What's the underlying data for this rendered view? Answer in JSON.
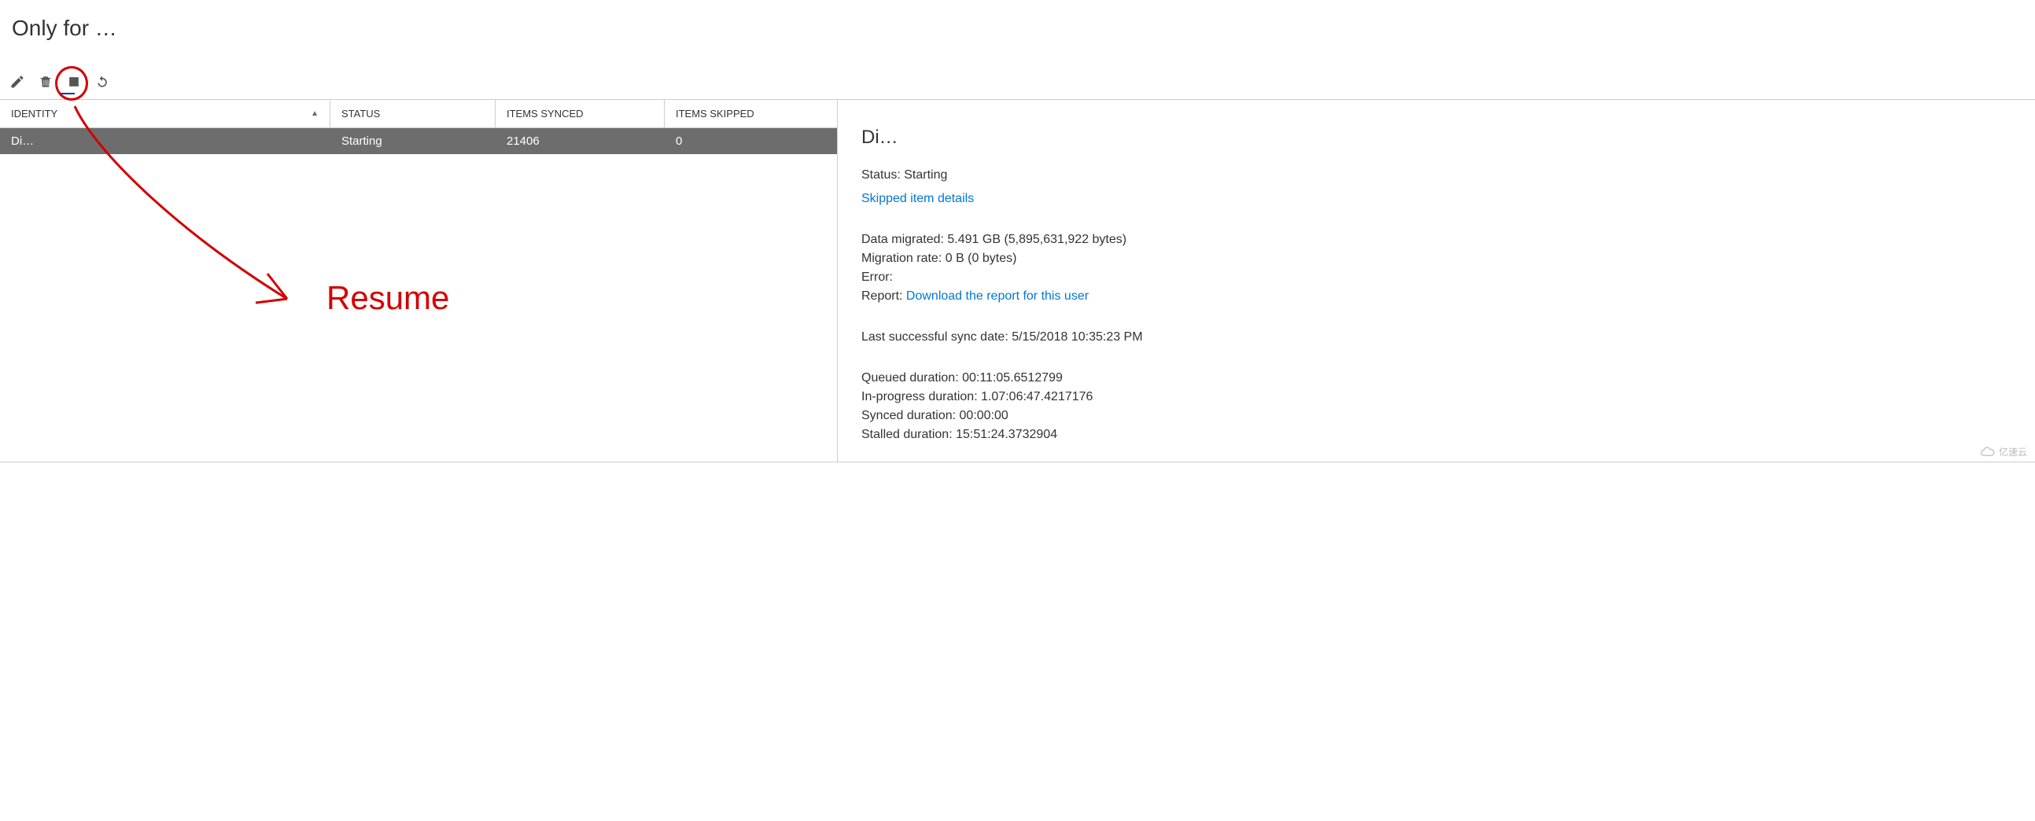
{
  "page": {
    "title": "Only for …"
  },
  "toolbar": {
    "edit": "edit",
    "delete": "delete",
    "stop": "stop",
    "refresh": "refresh"
  },
  "table": {
    "headers": {
      "identity": "IDENTITY",
      "status": "STATUS",
      "synced": "ITEMS SYNCED",
      "skipped": "ITEMS SKIPPED"
    },
    "rows": [
      {
        "identity": "Di…",
        "status": "Starting",
        "synced": "21406",
        "skipped": "0"
      }
    ]
  },
  "detail": {
    "title": "Di…",
    "status_label": "Status: ",
    "status_value": "Starting",
    "skipped_link": "Skipped item details",
    "data_migrated_label": "Data migrated: ",
    "data_migrated_value": "5.491 GB (5,895,631,922 bytes)",
    "migration_rate_label": "Migration rate: ",
    "migration_rate_value": "0 B (0 bytes)",
    "error_label": "Error:",
    "error_value": "",
    "report_label": "Report: ",
    "report_link": "Download the report for this user",
    "last_sync_label": "Last successful sync date: ",
    "last_sync_value": "5/15/2018 10:35:23 PM",
    "queued_label": "Queued duration: ",
    "queued_value": "00:11:05.6512799",
    "inprogress_label": "In-progress duration: ",
    "inprogress_value": "1.07:06:47.4217176",
    "synced_label": "Synced duration: ",
    "synced_value": "00:00:00",
    "stalled_label": "Stalled duration: ",
    "stalled_value": "15:51:24.3732904"
  },
  "annotation": {
    "text": "Resume"
  },
  "watermark": {
    "text": "亿速云"
  }
}
